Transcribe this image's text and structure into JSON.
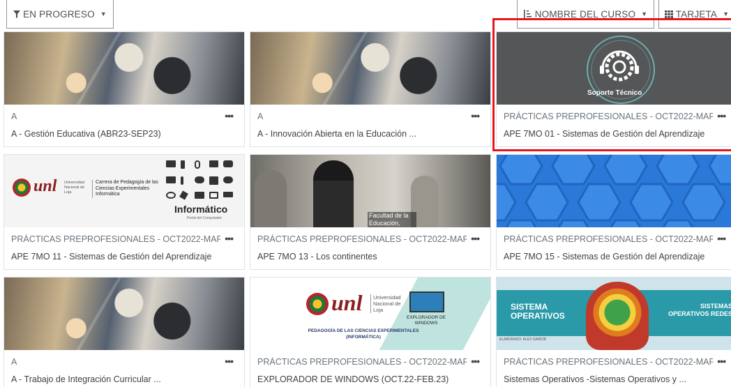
{
  "toolbar": {
    "progress_label": "EN PROGRESO",
    "sort_label": "NOMBRE DEL CURSO",
    "view_label": "TARJETA"
  },
  "cards": [
    {
      "category": "A",
      "name": "A - Gestión Educativa (ABR23-SEP23)",
      "image": "school-collage"
    },
    {
      "category": "A",
      "name": "A - Innovación Abierta en la Educación ...",
      "image": "school-collage"
    },
    {
      "category": "PRÁCTICAS PREPROFESIONALES - OCT2022-MAR...",
      "name": "APE 7MO 01 - Sistemas de Gestión del Aprendizaje",
      "image": "soporte-tecnico",
      "image_text": "Soporte Técnico"
    },
    {
      "category": "PRÁCTICAS PREPROFESIONALES - OCT2022-MAR...",
      "name": "APE 7MO 11 - Sistemas de Gestión del Aprendizaje",
      "image": "unl-informatica",
      "image_text": {
        "unl": "unl",
        "uni": "Universidad Nacional de Loja",
        "career": "Carrera de Pedagogía de las Ciencias Experimentales Informática",
        "title": "Informático",
        "subtitle": "Portal del Computador"
      }
    },
    {
      "category": "PRÁCTICAS PREPROFESIONALES - OCT2022-MAR...",
      "name": "APE 7MO 13 - Los continentes",
      "image": "students-statues",
      "image_text": "Facultad de la Educación,"
    },
    {
      "category": "PRÁCTICAS PREPROFESIONALES - OCT2022-MAR...",
      "name": "APE 7MO 15 - Sistemas de Gestión del Aprendizaje",
      "image": "blue-hexagons"
    },
    {
      "category": "A",
      "name": "A - Trabajo de Integración Curricular ...",
      "image": "school-collage"
    },
    {
      "category": "PRÁCTICAS PREPROFESIONALES - OCT2022-MAR...",
      "name": "EXPLORADOR DE WINDOWS (OCT.22-FEB.23)",
      "image": "unl-explorador",
      "image_text": {
        "unl": "unl",
        "uni": "Universidad Nacional de Loja",
        "label": "EXPLORADOR DE WINDOWS",
        "footer": "PEDAGOGÍA DE LAS CIENCIAS EXPERIMENTALES (INFORMÁTICA)"
      }
    },
    {
      "category": "PRÁCTICAS PREPROFESIONALES - OCT2022-MAR...",
      "name": "Sistemas Operativos -Sistemas Operativos y ...",
      "image": "sistemas-operativos",
      "image_text": {
        "left": "SISTEMA OPERATIVOS",
        "right": "SISTEMAS OPERATIVOS REDES",
        "credit": "ELABORADO: ALEX GAIBOR"
      }
    }
  ],
  "icons": {
    "filter": "filter-icon",
    "sort": "sort-icon",
    "grid": "grid-icon",
    "more": "more-icon"
  },
  "colors": {
    "highlight": "#e8161c",
    "hex_blue": "#2a78d7"
  }
}
